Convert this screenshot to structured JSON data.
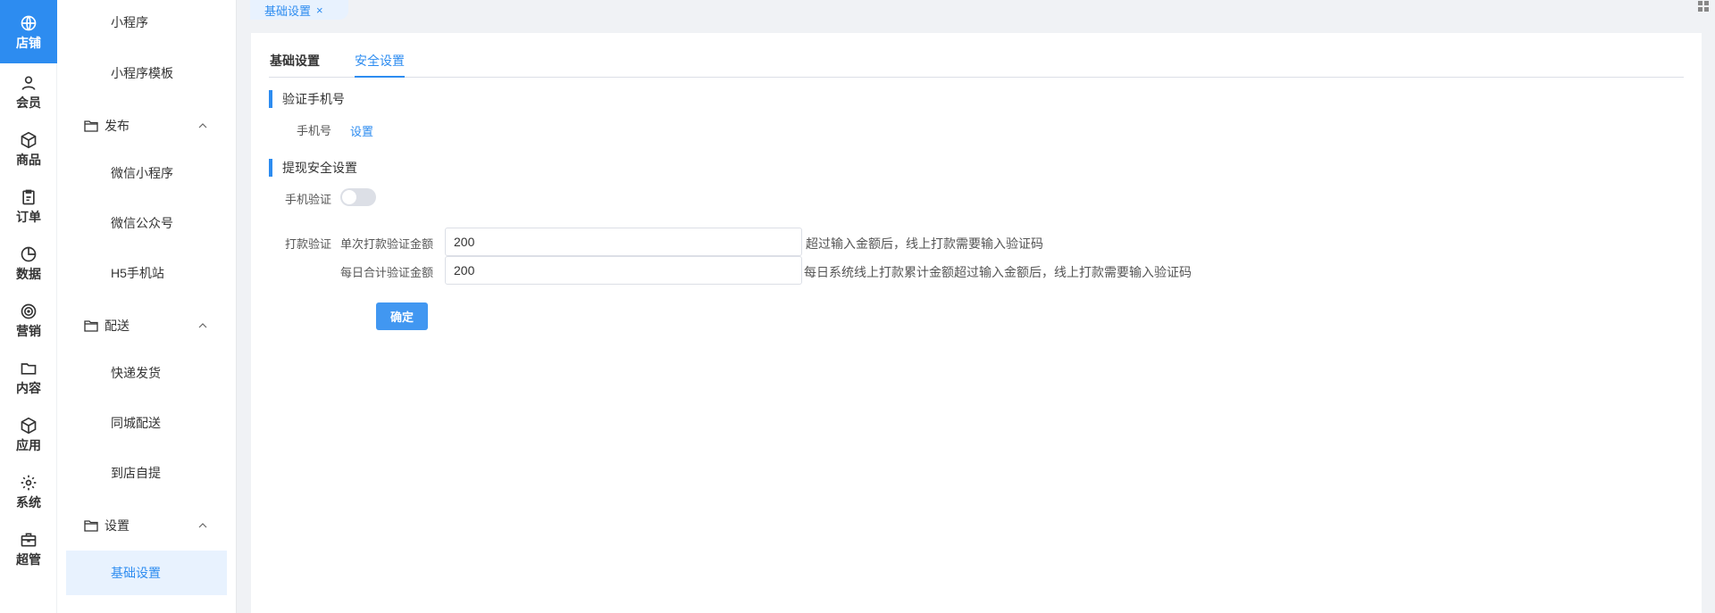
{
  "rail": {
    "items": [
      {
        "label": "店铺",
        "icon": "globe-icon"
      },
      {
        "label": "会员",
        "icon": "user-icon"
      },
      {
        "label": "商品",
        "icon": "box-icon"
      },
      {
        "label": "订单",
        "icon": "clipboard-icon"
      },
      {
        "label": "数据",
        "icon": "pie-chart-icon"
      },
      {
        "label": "营销",
        "icon": "target-icon"
      },
      {
        "label": "内容",
        "icon": "folder-icon"
      },
      {
        "label": "应用",
        "icon": "cube-icon"
      },
      {
        "label": "系统",
        "icon": "gear-icon"
      },
      {
        "label": "超管",
        "icon": "briefcase-icon"
      }
    ]
  },
  "sidebar": {
    "top_items": [
      "小程序",
      "小程序模板"
    ],
    "groups": [
      {
        "label": "发布",
        "items": [
          "微信小程序",
          "微信公众号",
          "H5手机站"
        ]
      },
      {
        "label": "配送",
        "items": [
          "快递发货",
          "同城配送",
          "到店自提"
        ]
      },
      {
        "label": "设置",
        "items": [
          "基础设置"
        ]
      }
    ]
  },
  "tabstrip": {
    "tab_label": "基础设置",
    "close": "×"
  },
  "subtabs": {
    "basic": "基础设置",
    "security": "安全设置"
  },
  "phone_section": {
    "title": "验证手机号",
    "label": "手机号",
    "link": "设置"
  },
  "withdraw_section": {
    "title": "提现安全设置",
    "phone_verify_label": "手机验证",
    "phone_verify_on": false,
    "payment_label": "打款验证",
    "single_label": "单次打款验证金额",
    "single_value": "200",
    "single_hint": "超过输入金额后，线上打款需要输入验证码",
    "daily_label": "每日合计验证金额",
    "daily_value": "200",
    "daily_hint": "每日系统线上打款累计金额超过输入金额后，线上打款需要输入验证码"
  },
  "confirm_button": "确定",
  "colors": {
    "accent": "#2d8cf0",
    "background": "#f0f2f5"
  }
}
